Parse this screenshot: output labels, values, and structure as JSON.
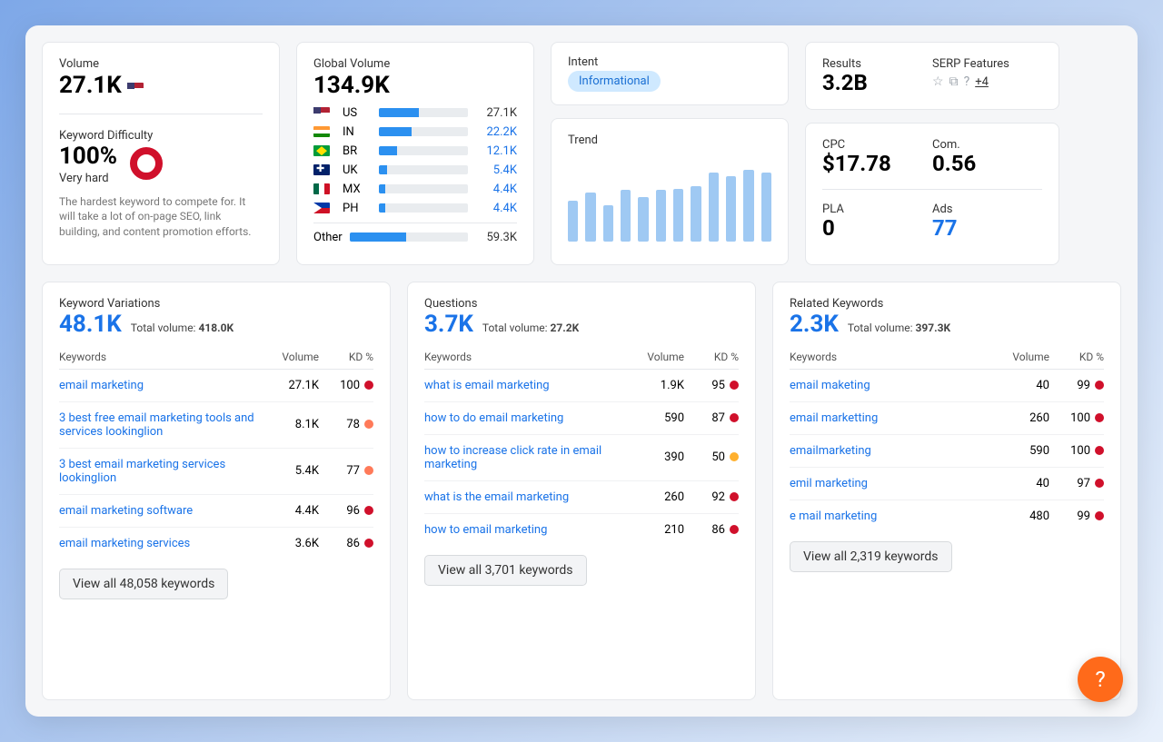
{
  "volume": {
    "label": "Volume",
    "value": "27.1K",
    "flag": "us"
  },
  "kd": {
    "label": "Keyword Difficulty",
    "pct": "100%",
    "level": "Very hard",
    "desc": "The hardest keyword to compete for. It will take a lot of on-page SEO, link building, and content promotion efforts."
  },
  "global": {
    "label": "Global Volume",
    "value": "134.9K",
    "rows": [
      {
        "cc": "US",
        "flag": "us",
        "pct": 45,
        "val": "27.1K",
        "cls": "dark"
      },
      {
        "cc": "IN",
        "flag": "in",
        "pct": 37,
        "val": "22.2K"
      },
      {
        "cc": "BR",
        "flag": "br",
        "pct": 20,
        "val": "12.1K"
      },
      {
        "cc": "UK",
        "flag": "uk",
        "pct": 9,
        "val": "5.4K"
      },
      {
        "cc": "MX",
        "flag": "mx",
        "pct": 7,
        "val": "4.4K"
      },
      {
        "cc": "PH",
        "flag": "ph",
        "pct": 7,
        "val": "4.4K"
      }
    ],
    "other": {
      "cc": "Other",
      "pct": 48,
      "val": "59.3K"
    }
  },
  "intent": {
    "label": "Intent",
    "badge": "Informational"
  },
  "trend": {
    "label": "Trend"
  },
  "chart_data": {
    "type": "bar",
    "title": "Trend",
    "categories": [
      "1",
      "2",
      "3",
      "4",
      "5",
      "6",
      "7",
      "8",
      "9",
      "10",
      "11",
      "12"
    ],
    "values": [
      50,
      60,
      45,
      63,
      55,
      63,
      65,
      68,
      85,
      80,
      88,
      85
    ],
    "ylim": [
      0,
      100
    ]
  },
  "results": {
    "label": "Results",
    "value": "3.2B"
  },
  "serp": {
    "label": "SERP Features",
    "more": "+4"
  },
  "cpc": {
    "label": "CPC",
    "value": "$17.78"
  },
  "com": {
    "label": "Com.",
    "value": "0.56"
  },
  "pla": {
    "label": "PLA",
    "value": "0"
  },
  "ads": {
    "label": "Ads",
    "value": "77"
  },
  "variations": {
    "title": "Keyword Variations",
    "count": "48.1K",
    "totalLabel": "Total volume:",
    "total": "418.0K",
    "cols": {
      "kw": "Keywords",
      "vol": "Volume",
      "kd": "KD %"
    },
    "rows": [
      {
        "kw": "email marketing",
        "vol": "27.1K",
        "kd": "100",
        "color": "#d0102b"
      },
      {
        "kw": "3 best free email marketing tools and services lookinglion",
        "vol": "8.1K",
        "kd": "78",
        "color": "#ff7a59"
      },
      {
        "kw": "3 best email marketing services lookinglion",
        "vol": "5.4K",
        "kd": "77",
        "color": "#ff7a59"
      },
      {
        "kw": "email marketing software",
        "vol": "4.4K",
        "kd": "96",
        "color": "#d0102b"
      },
      {
        "kw": "email marketing services",
        "vol": "3.6K",
        "kd": "86",
        "color": "#d0102b"
      }
    ],
    "btn": "View all 48,058 keywords"
  },
  "questions": {
    "title": "Questions",
    "count": "3.7K",
    "totalLabel": "Total volume:",
    "total": "27.2K",
    "cols": {
      "kw": "Keywords",
      "vol": "Volume",
      "kd": "KD %"
    },
    "rows": [
      {
        "kw": "what is email marketing",
        "vol": "1.9K",
        "kd": "95",
        "color": "#d0102b"
      },
      {
        "kw": "how to do email marketing",
        "vol": "590",
        "kd": "87",
        "color": "#d0102b"
      },
      {
        "kw": "how to increase click rate in email marketing",
        "vol": "390",
        "kd": "50",
        "color": "#ffb02e"
      },
      {
        "kw": "what is the email marketing",
        "vol": "260",
        "kd": "92",
        "color": "#d0102b"
      },
      {
        "kw": "how to email marketing",
        "vol": "210",
        "kd": "86",
        "color": "#d0102b"
      }
    ],
    "btn": "View all 3,701 keywords"
  },
  "related": {
    "title": "Related Keywords",
    "count": "2.3K",
    "totalLabel": "Total volume:",
    "total": "397.3K",
    "cols": {
      "kw": "Keywords",
      "vol": "Volume",
      "kd": "KD %"
    },
    "rows": [
      {
        "kw": "email maketing",
        "vol": "40",
        "kd": "99",
        "color": "#d0102b"
      },
      {
        "kw": "email marketting",
        "vol": "260",
        "kd": "100",
        "color": "#d0102b"
      },
      {
        "kw": "emailmarketing",
        "vol": "590",
        "kd": "100",
        "color": "#d0102b"
      },
      {
        "kw": "emil marketing",
        "vol": "40",
        "kd": "97",
        "color": "#d0102b"
      },
      {
        "kw": "e mail marketing",
        "vol": "480",
        "kd": "99",
        "color": "#d0102b"
      }
    ],
    "btn": "View all 2,319 keywords"
  }
}
